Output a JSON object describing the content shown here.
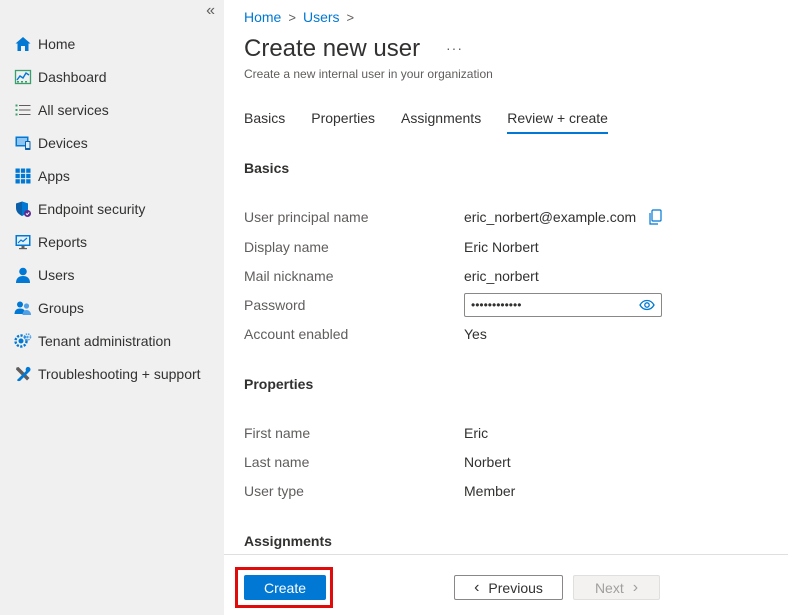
{
  "sidebar": {
    "collapse_glyph": "«",
    "items": [
      {
        "label": "Home",
        "icon": "home-icon"
      },
      {
        "label": "Dashboard",
        "icon": "dashboard-icon"
      },
      {
        "label": "All services",
        "icon": "list-icon"
      },
      {
        "label": "Devices",
        "icon": "devices-icon"
      },
      {
        "label": "Apps",
        "icon": "apps-grid-icon"
      },
      {
        "label": "Endpoint security",
        "icon": "shield-icon"
      },
      {
        "label": "Reports",
        "icon": "reports-icon"
      },
      {
        "label": "Users",
        "icon": "user-icon"
      },
      {
        "label": "Groups",
        "icon": "groups-icon"
      },
      {
        "label": "Tenant administration",
        "icon": "tenant-gear-icon"
      },
      {
        "label": "Troubleshooting + support",
        "icon": "tools-icon"
      }
    ]
  },
  "breadcrumb": {
    "home": "Home",
    "users": "Users",
    "sep": ">"
  },
  "page": {
    "title": "Create new user",
    "more": "···",
    "subtitle": "Create a new internal user in your organization"
  },
  "tabs": [
    {
      "label": "Basics",
      "active": false
    },
    {
      "label": "Properties",
      "active": false
    },
    {
      "label": "Assignments",
      "active": false
    },
    {
      "label": "Review + create",
      "active": true
    }
  ],
  "basics": {
    "title": "Basics",
    "upn_label": "User principal name",
    "upn_value": "eric_norbert@example.com",
    "display_label": "Display name",
    "display_value": "Eric Norbert",
    "mail_label": "Mail nickname",
    "mail_value": "eric_norbert",
    "password_label": "Password",
    "password_value": "••••••••••••",
    "enabled_label": "Account enabled",
    "enabled_value": "Yes"
  },
  "properties": {
    "title": "Properties",
    "first_label": "First name",
    "first_value": "Eric",
    "last_label": "Last name",
    "last_value": "Norbert",
    "type_label": "User type",
    "type_value": "Member"
  },
  "assignments": {
    "title": "Assignments"
  },
  "footer": {
    "create": "Create",
    "previous": "Previous",
    "next": "Next",
    "prev_glyph": "‹",
    "next_glyph": "›"
  },
  "colors": {
    "accent": "#0078d4",
    "highlight": "#e00b0b",
    "sidebar_bg": "#f0f0f0"
  }
}
